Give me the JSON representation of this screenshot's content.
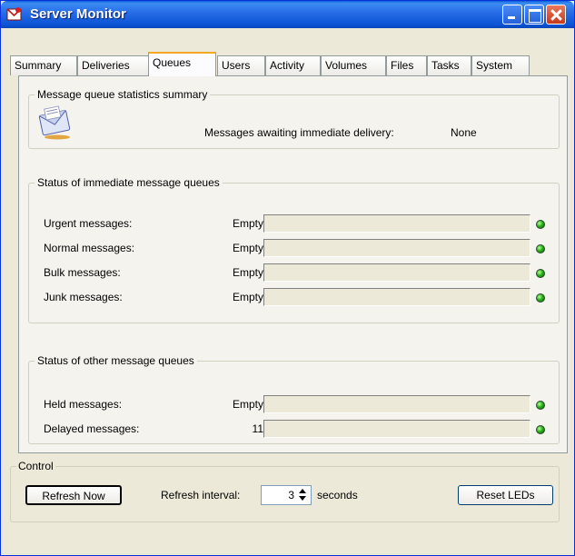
{
  "window": {
    "title": "Server Monitor"
  },
  "tabs": [
    {
      "label": "Summary"
    },
    {
      "label": "Deliveries"
    },
    {
      "label": "Queues"
    },
    {
      "label": "Users"
    },
    {
      "label": "Activity"
    },
    {
      "label": "Volumes"
    },
    {
      "label": "Files"
    },
    {
      "label": "Tasks"
    },
    {
      "label": "System"
    }
  ],
  "active_tab": "Queues",
  "summary_group": {
    "title": "Message queue statistics summary",
    "awaiting_label": "Messages awaiting immediate delivery:",
    "awaiting_value": "None"
  },
  "immediate_group": {
    "title": "Status of immediate message queues",
    "rows": [
      {
        "label": "Urgent messages:",
        "status": "Empty",
        "fill": 0,
        "led": "green"
      },
      {
        "label": "Normal messages:",
        "status": "Empty",
        "fill": 0,
        "led": "green"
      },
      {
        "label": "Bulk messages:",
        "status": "Empty",
        "fill": 0,
        "led": "green"
      },
      {
        "label": "Junk messages:",
        "status": "Empty",
        "fill": 0,
        "led": "green"
      }
    ]
  },
  "other_group": {
    "title": "Status of other message queues",
    "rows": [
      {
        "label": "Held messages:",
        "status": "Empty",
        "fill": 0,
        "led": "green"
      },
      {
        "label": "Delayed messages:",
        "status": "11",
        "fill": 0,
        "led": "green"
      }
    ]
  },
  "control": {
    "title": "Control",
    "refresh_button": "Refresh Now",
    "interval_label": "Refresh interval:",
    "interval_value": "3",
    "interval_unit": "seconds",
    "reset_button": "Reset LEDs"
  },
  "colors": {
    "titlebar": "#0a53d4",
    "led_ok": "#2ab21a",
    "active_tab_accent": "#f5a823"
  }
}
